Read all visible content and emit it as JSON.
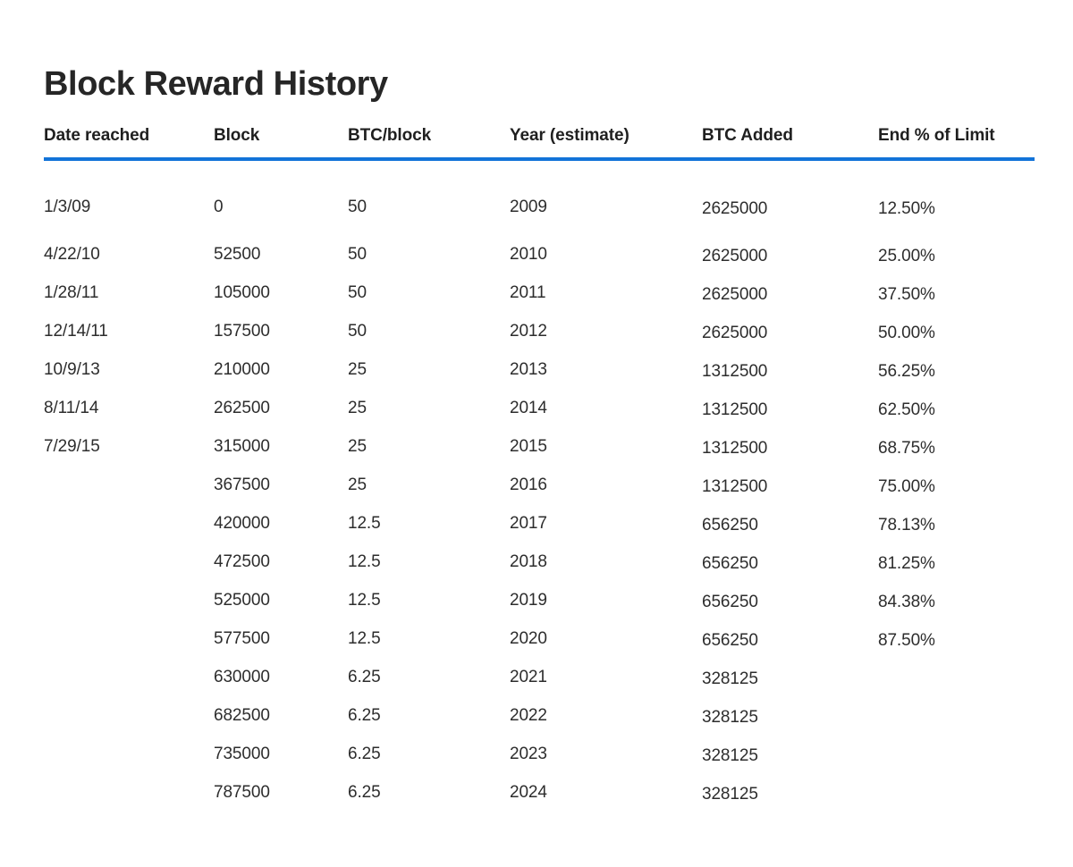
{
  "page": {
    "title": "Block Reward History",
    "accent_color": "#1273d8",
    "title_color": "#262626",
    "text_color": "#2d2d2d",
    "background_color": "#ffffff"
  },
  "table": {
    "columns": [
      {
        "key": "date",
        "label": "Date reached"
      },
      {
        "key": "block",
        "label": "Block"
      },
      {
        "key": "btc",
        "label": "BTC/block"
      },
      {
        "key": "year",
        "label": "Year (estimate)"
      },
      {
        "key": "added",
        "label": "BTC Added"
      },
      {
        "key": "pct",
        "label": "End % of Limit"
      }
    ],
    "rows": [
      {
        "date": "1/3/09",
        "block": "0",
        "btc": "50",
        "year": "2009",
        "added": "2625000",
        "pct": "12.50%"
      },
      {
        "date": "4/22/10",
        "block": "52500",
        "btc": "50",
        "year": "2010",
        "added": "2625000",
        "pct": "25.00%"
      },
      {
        "date": "1/28/11",
        "block": "105000",
        "btc": "50",
        "year": "2011",
        "added": "2625000",
        "pct": "37.50%"
      },
      {
        "date": "12/14/11",
        "block": "157500",
        "btc": "50",
        "year": "2012",
        "added": "2625000",
        "pct": "50.00%"
      },
      {
        "date": "10/9/13",
        "block": "210000",
        "btc": "25",
        "year": "2013",
        "added": "1312500",
        "pct": "56.25%"
      },
      {
        "date": "8/11/14",
        "block": "262500",
        "btc": "25",
        "year": "2014",
        "added": "1312500",
        "pct": "62.50%"
      },
      {
        "date": "7/29/15",
        "block": "315000",
        "btc": "25",
        "year": "2015",
        "added": "1312500",
        "pct": "68.75%"
      },
      {
        "date": "",
        "block": "367500",
        "btc": "25",
        "year": "2016",
        "added": "1312500",
        "pct": "75.00%"
      },
      {
        "date": "",
        "block": "420000",
        "btc": "12.5",
        "year": "2017",
        "added": "656250",
        "pct": "78.13%"
      },
      {
        "date": "",
        "block": "472500",
        "btc": "12.5",
        "year": "2018",
        "added": "656250",
        "pct": "81.25%"
      },
      {
        "date": "",
        "block": "525000",
        "btc": "12.5",
        "year": "2019",
        "added": "656250",
        "pct": "84.38%"
      },
      {
        "date": "",
        "block": "577500",
        "btc": "12.5",
        "year": "2020",
        "added": "656250",
        "pct": "87.50%"
      },
      {
        "date": "",
        "block": "630000",
        "btc": "6.25",
        "year": "2021",
        "added": "328125",
        "pct": ""
      },
      {
        "date": "",
        "block": "682500",
        "btc": "6.25",
        "year": "2022",
        "added": "328125",
        "pct": ""
      },
      {
        "date": "",
        "block": "735000",
        "btc": "6.25",
        "year": "2023",
        "added": "328125",
        "pct": ""
      },
      {
        "date": "",
        "block": "787500",
        "btc": "6.25",
        "year": "2024",
        "added": "328125",
        "pct": ""
      }
    ]
  }
}
